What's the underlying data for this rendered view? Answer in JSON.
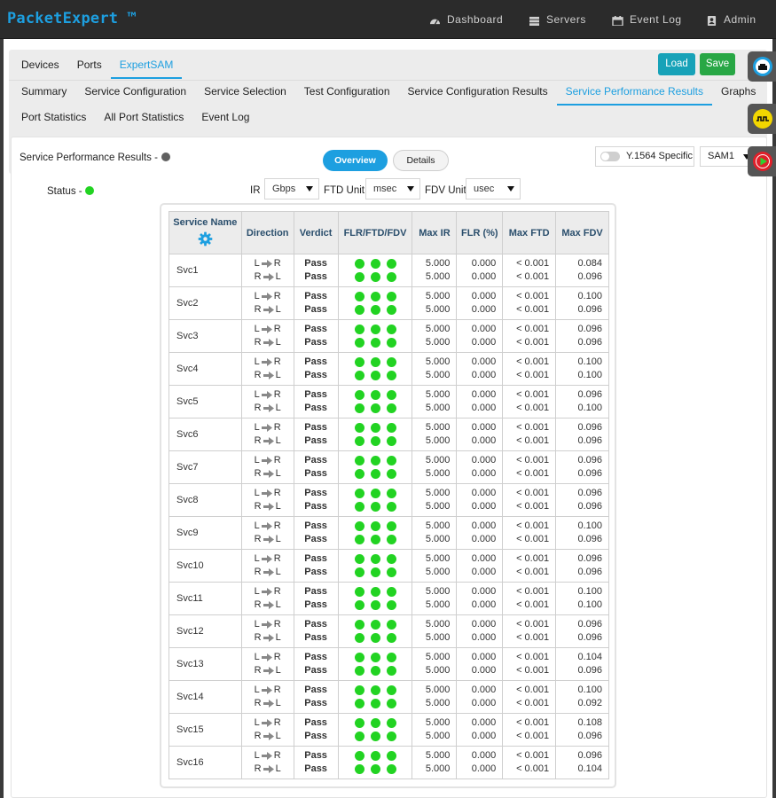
{
  "app": {
    "brand": "PacketExpert ™",
    "nav": [
      {
        "label": "Dashboard",
        "icon": "dashboard-icon"
      },
      {
        "label": "Servers",
        "icon": "servers-icon"
      },
      {
        "label": "Event Log",
        "icon": "calendar-icon"
      },
      {
        "label": "Admin",
        "icon": "user-icon"
      }
    ]
  },
  "tabs": {
    "row1": [
      "Devices",
      "Ports",
      "ExpertSAM"
    ],
    "row1_active": "ExpertSAM",
    "row2": [
      "Summary",
      "Service Configuration",
      "Service Selection",
      "Test Configuration",
      "Service Configuration Results",
      "Service Performance Results",
      "Graphs"
    ],
    "row2_active": "Service Performance Results",
    "row3": [
      "Port Statistics",
      "All Port Statistics",
      "Event Log"
    ]
  },
  "buttons": {
    "load": "Load",
    "save": "Save"
  },
  "panel": {
    "title": "Service Performance Results -",
    "overview": "Overview",
    "details": "Details",
    "y1564": "Y.1564 Specific",
    "sam": "SAM1",
    "status_label": "Status -",
    "ir_label": "IR",
    "ir_value": "Gbps",
    "ftd_label": "FTD Unit",
    "ftd_value": "msec",
    "fdv_label": "FDV Unit",
    "fdv_value": "usec"
  },
  "table": {
    "headers": [
      "Service Name",
      "Direction",
      "Verdict",
      "FLR/FTD/FDV",
      "Max IR",
      "FLR (%)",
      "Max FTD",
      "Max FDV"
    ],
    "dir_lr": [
      "L",
      "R"
    ],
    "dir_rl": [
      "R",
      "L"
    ],
    "rows": [
      {
        "name": "Svc1",
        "v1": "Pass",
        "v2": "Pass",
        "ir1": "5.000",
        "ir2": "5.000",
        "flr1": "0.000",
        "flr2": "0.000",
        "ftd1": "< 0.001",
        "ftd2": "< 0.001",
        "fdv1": "0.084",
        "fdv2": "0.096"
      },
      {
        "name": "Svc2",
        "v1": "Pass",
        "v2": "Pass",
        "ir1": "5.000",
        "ir2": "5.000",
        "flr1": "0.000",
        "flr2": "0.000",
        "ftd1": "< 0.001",
        "ftd2": "< 0.001",
        "fdv1": "0.100",
        "fdv2": "0.096"
      },
      {
        "name": "Svc3",
        "v1": "Pass",
        "v2": "Pass",
        "ir1": "5.000",
        "ir2": "5.000",
        "flr1": "0.000",
        "flr2": "0.000",
        "ftd1": "< 0.001",
        "ftd2": "< 0.001",
        "fdv1": "0.096",
        "fdv2": "0.096"
      },
      {
        "name": "Svc4",
        "v1": "Pass",
        "v2": "Pass",
        "ir1": "5.000",
        "ir2": "5.000",
        "flr1": "0.000",
        "flr2": "0.000",
        "ftd1": "< 0.001",
        "ftd2": "< 0.001",
        "fdv1": "0.100",
        "fdv2": "0.100"
      },
      {
        "name": "Svc5",
        "v1": "Pass",
        "v2": "Pass",
        "ir1": "5.000",
        "ir2": "5.000",
        "flr1": "0.000",
        "flr2": "0.000",
        "ftd1": "< 0.001",
        "ftd2": "< 0.001",
        "fdv1": "0.096",
        "fdv2": "0.100"
      },
      {
        "name": "Svc6",
        "v1": "Pass",
        "v2": "Pass",
        "ir1": "5.000",
        "ir2": "5.000",
        "flr1": "0.000",
        "flr2": "0.000",
        "ftd1": "< 0.001",
        "ftd2": "< 0.001",
        "fdv1": "0.096",
        "fdv2": "0.096"
      },
      {
        "name": "Svc7",
        "v1": "Pass",
        "v2": "Pass",
        "ir1": "5.000",
        "ir2": "5.000",
        "flr1": "0.000",
        "flr2": "0.000",
        "ftd1": "< 0.001",
        "ftd2": "< 0.001",
        "fdv1": "0.096",
        "fdv2": "0.096"
      },
      {
        "name": "Svc8",
        "v1": "Pass",
        "v2": "Pass",
        "ir1": "5.000",
        "ir2": "5.000",
        "flr1": "0.000",
        "flr2": "0.000",
        "ftd1": "< 0.001",
        "ftd2": "< 0.001",
        "fdv1": "0.096",
        "fdv2": "0.096"
      },
      {
        "name": "Svc9",
        "v1": "Pass",
        "v2": "Pass",
        "ir1": "5.000",
        "ir2": "5.000",
        "flr1": "0.000",
        "flr2": "0.000",
        "ftd1": "< 0.001",
        "ftd2": "< 0.001",
        "fdv1": "0.100",
        "fdv2": "0.096"
      },
      {
        "name": "Svc10",
        "v1": "Pass",
        "v2": "Pass",
        "ir1": "5.000",
        "ir2": "5.000",
        "flr1": "0.000",
        "flr2": "0.000",
        "ftd1": "< 0.001",
        "ftd2": "< 0.001",
        "fdv1": "0.096",
        "fdv2": "0.096"
      },
      {
        "name": "Svc11",
        "v1": "Pass",
        "v2": "Pass",
        "ir1": "5.000",
        "ir2": "5.000",
        "flr1": "0.000",
        "flr2": "0.000",
        "ftd1": "< 0.001",
        "ftd2": "< 0.001",
        "fdv1": "0.100",
        "fdv2": "0.100"
      },
      {
        "name": "Svc12",
        "v1": "Pass",
        "v2": "Pass",
        "ir1": "5.000",
        "ir2": "5.000",
        "flr1": "0.000",
        "flr2": "0.000",
        "ftd1": "< 0.001",
        "ftd2": "< 0.001",
        "fdv1": "0.096",
        "fdv2": "0.096"
      },
      {
        "name": "Svc13",
        "v1": "Pass",
        "v2": "Pass",
        "ir1": "5.000",
        "ir2": "5.000",
        "flr1": "0.000",
        "flr2": "0.000",
        "ftd1": "< 0.001",
        "ftd2": "< 0.001",
        "fdv1": "0.104",
        "fdv2": "0.096"
      },
      {
        "name": "Svc14",
        "v1": "Pass",
        "v2": "Pass",
        "ir1": "5.000",
        "ir2": "5.000",
        "flr1": "0.000",
        "flr2": "0.000",
        "ftd1": "< 0.001",
        "ftd2": "< 0.001",
        "fdv1": "0.100",
        "fdv2": "0.092"
      },
      {
        "name": "Svc15",
        "v1": "Pass",
        "v2": "Pass",
        "ir1": "5.000",
        "ir2": "5.000",
        "flr1": "0.000",
        "flr2": "0.000",
        "ftd1": "< 0.001",
        "ftd2": "< 0.001",
        "fdv1": "0.108",
        "fdv2": "0.096"
      },
      {
        "name": "Svc16",
        "v1": "Pass",
        "v2": "Pass",
        "ir1": "5.000",
        "ir2": "5.000",
        "flr1": "0.000",
        "flr2": "0.000",
        "ftd1": "< 0.001",
        "ftd2": "< 0.001",
        "fdv1": "0.096",
        "fdv2": "0.104"
      }
    ]
  },
  "colors": {
    "brand": "#1d9fe0",
    "pass": "#29a329",
    "status_ok": "#22d322",
    "load_button": "#17a2b8",
    "save_button": "#28a745"
  },
  "side_buttons": [
    {
      "icon": "ethernet-port-icon",
      "color": "#1d9fe0"
    },
    {
      "icon": "waveform-icon",
      "color": "#f2d600"
    },
    {
      "icon": "play-icon",
      "color": "#e0202a"
    }
  ]
}
